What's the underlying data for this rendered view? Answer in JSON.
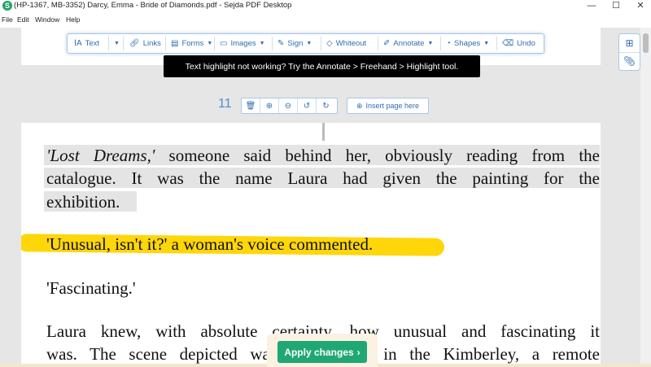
{
  "window": {
    "title": "(HP-1367, MB-3352) Darcy, Emma - Bride of Diamonds.pdf - Sejda PDF Desktop",
    "app_icon_letter": "S",
    "minimize": "—",
    "maximize": "☐",
    "close": "✕"
  },
  "menu": [
    "File",
    "Edit",
    "Window",
    "Help"
  ],
  "toolbar": {
    "text": "Text",
    "links": "Links",
    "forms": "Forms",
    "images": "Images",
    "sign": "Sign",
    "whiteout": "Whiteout",
    "annotate": "Annotate",
    "shapes": "Shapes",
    "undo": "Undo"
  },
  "tooltip": "Text highlight not working? Try the Annotate > Freehand > Highlight tool.",
  "page_controls": {
    "page_number": "11",
    "insert_label": "Insert page here"
  },
  "document": {
    "para1_italic": "'Lost Dreams,'",
    "para1_line1_rest": " someone said behind her, obviously reading from the",
    "para1_line2": "catalogue. It was the name Laura had given the painting for the",
    "para1_line3": "exhibition.",
    "para2": "'Unusual, isn't it?' a woman's voice commented.",
    "para3": "'Fascinating.'",
    "para4_line1": "Laura knew, with absolute certainty, how unusual and fascinating it",
    "para4_line2": "was. The scene depicted was of a mine in the Kimberley, a remote"
  },
  "apply_button": "Apply changes",
  "colors": {
    "accent": "#2f6db3",
    "apply_green": "#20a874",
    "highlight_yellow": "#ffd60a"
  }
}
